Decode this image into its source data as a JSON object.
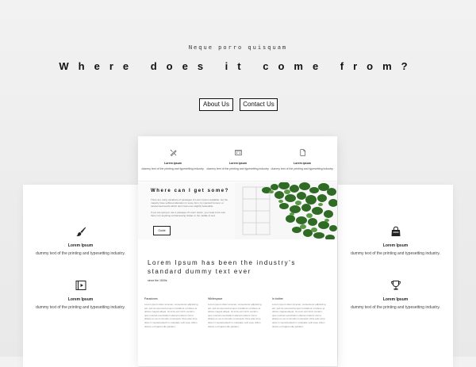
{
  "hero": {
    "subtitle": "Neque porro quisquam",
    "title": "Where does it come from?",
    "buttons": [
      "About Us",
      "Contact Us"
    ]
  },
  "left_card": {
    "features": [
      {
        "icon": "paintbrush-icon",
        "title": "Lorem Ipsum",
        "desc": "dummy text of the printing and typesetting industry."
      },
      {
        "icon": "video-icon",
        "title": "Lorem Ipsum",
        "desc": "dummy text of the printing and typesetting industry."
      }
    ]
  },
  "right_card": {
    "features": [
      {
        "icon": "shopping-bag-icon",
        "title": "Lorem Ipsum",
        "desc": "dummy text of the printing and typesetting industry."
      },
      {
        "icon": "trophy-icon",
        "title": "Lorem Ipsum",
        "desc": "dummy text of the printing and typesetting industry."
      }
    ]
  },
  "center_card": {
    "top_features": [
      {
        "icon": "pencil-ruler-icon",
        "title": "Lorem ipsum",
        "desc": "dummy text of the printing and typesetting industry."
      },
      {
        "icon": "browser-code-icon",
        "title": "Lorem ipsum",
        "desc": "dummy text of the printing and typesetting industry."
      },
      {
        "icon": "document-icon",
        "title": "Lorem ipsum",
        "desc": "dummy text of the printing and typesetting industry."
      }
    ],
    "where": {
      "title": "Where can I get some?",
      "p1": "There are many variations of passages of Lorem Ipsum available, but the majority have suffered alteration in some form, by injected humour, or randomised words which don't look even slightly believable.",
      "p2": "If you are going to use a passage of Lorem Ipsum, you need to be sure there isn't anything embarrassing hidden in the middle of text.",
      "button": "Guide"
    },
    "lorem_title": "Lorem Ipsum has been the industry's standard dummy text ever",
    "since": "since the 1500s",
    "columns": [
      {
        "heading": "Paradoxes",
        "body": "Lorem ipsum dolor sit amet, consectetur adipiscing elit, sed do eiusmod tempor incididunt ut labore et dolore magna aliqua. Ut enim ad minim veniam, quis nostrud exercitation ullamco laboris nisi ut aliquip ex ea commodo consequat. Duis aute irure dolor in reprehenderit in voluptate velit esse cillum dolore eu fugiat nulla pariatur."
      },
      {
        "heading": "Whitespace",
        "body": "Lorem ipsum dolor sit amet, consectetur adipiscing elit, sed do eiusmod tempor incididunt ut labore et dolore magna aliqua. Ut enim ad minim veniam, quis nostrud exercitation ullamco laboris nisi ut aliquip ex ea commodo consequat. Duis aute irure dolor in reprehenderit in voluptate velit esse cillum dolore eu fugiat nulla pariatur."
      },
      {
        "heading": "In bother",
        "body": "Lorem ipsum dolor sit amet, consectetur adipiscing elit, sed do eiusmod tempor incididunt ut labore et dolore magna aliqua. Ut enim ad minim veniam, quis nostrud exercitation ullamco laboris nisi ut aliquip ex ea commodo consequat. Duis aute irure dolor in reprehenderit in voluptate velit esse cillum dolore eu fugiat nulla pariatur."
      }
    ]
  }
}
